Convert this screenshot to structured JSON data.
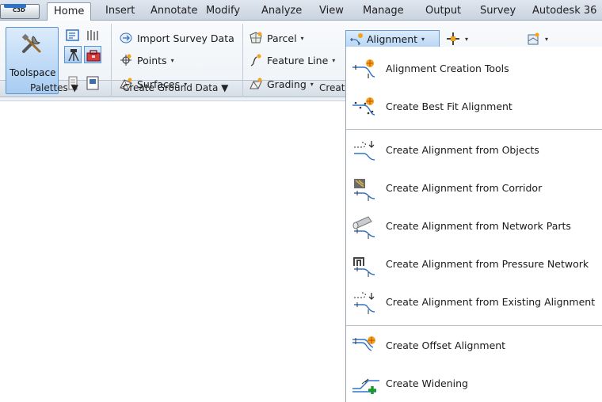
{
  "app_button": {
    "label": "C3D"
  },
  "tabs": [
    {
      "label": "Home",
      "active": true
    },
    {
      "label": "Insert"
    },
    {
      "label": "Annotate"
    },
    {
      "label": "Modify"
    },
    {
      "label": "Analyze"
    },
    {
      "label": "View"
    },
    {
      "label": "Manage"
    },
    {
      "label": "Output"
    },
    {
      "label": "Survey"
    },
    {
      "label": "Autodesk 36"
    }
  ],
  "palettes_panel": {
    "toolspace_label": "Toolspace",
    "title": "Palettes ▼"
  },
  "ground_panel": {
    "items": [
      {
        "label": "Import Survey Data",
        "icon": "import-survey-icon"
      },
      {
        "label": "Points",
        "icon": "points-icon",
        "dropdown": true
      },
      {
        "label": "Surfaces",
        "icon": "surfaces-icon",
        "dropdown": true
      }
    ],
    "title": "Create Ground Data ▼"
  },
  "design_panel": {
    "items": [
      {
        "label": "Parcel",
        "icon": "parcel-icon",
        "dropdown": true
      },
      {
        "label": "Feature Line",
        "icon": "feature-line-icon",
        "dropdown": true
      },
      {
        "label": "Grading",
        "icon": "grading-icon",
        "dropdown": true
      }
    ],
    "title": "Creat"
  },
  "alignment_button": {
    "label": "Alignment",
    "caret": "▾"
  },
  "caret_glyph": "▾",
  "alignment_menu": {
    "items": [
      {
        "label": "Alignment Creation Tools",
        "icon": "alignment-tools-icon"
      },
      {
        "label": "Create Best Fit Alignment",
        "icon": "best-fit-icon"
      },
      {
        "label": "Create Alignment from Objects",
        "icon": "from-objects-icon"
      },
      {
        "label": "Create Alignment from Corridor",
        "icon": "from-corridor-icon"
      },
      {
        "label": "Create Alignment from Network Parts",
        "icon": "network-parts-icon"
      },
      {
        "label": "Create Alignment from Pressure Network",
        "icon": "pressure-network-icon"
      },
      {
        "label": "Create Alignment from Existing Alignment",
        "icon": "existing-alignment-icon"
      },
      {
        "label": "Create Offset Alignment",
        "icon": "offset-alignment-icon"
      },
      {
        "label": "Create Widening",
        "icon": "widening-icon"
      }
    ]
  },
  "colors": {
    "ribbon_bg": "#eef2f6",
    "highlight": "#b8d6f5",
    "accent_orange": "#f2a21b",
    "accent_blue": "#2f73c8",
    "accent_green": "#1a9a2a"
  }
}
